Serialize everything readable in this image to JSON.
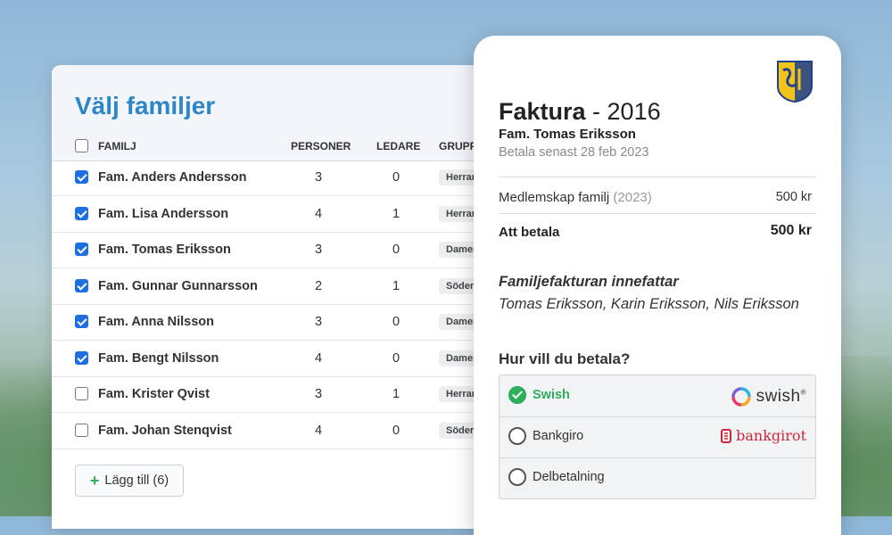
{
  "families_panel": {
    "title": "Välj familjer",
    "columns": {
      "family": "FAMILJ",
      "persons": "PERSONER",
      "leaders": "LEDARE",
      "group": "GRUPP"
    },
    "rows": [
      {
        "name": "Fam. Anders Andersson",
        "persons": "3",
        "leaders": "0",
        "group": "Herrar",
        "checked": true
      },
      {
        "name": "Fam. Lisa Andersson",
        "persons": "4",
        "leaders": "1",
        "group": "Herrar",
        "checked": true
      },
      {
        "name": "Fam. Tomas Eriksson",
        "persons": "3",
        "leaders": "0",
        "group": "Damer",
        "checked": true
      },
      {
        "name": "Fam. Gunnar Gunnarsson",
        "persons": "2",
        "leaders": "1",
        "group": "Söder",
        "checked": true
      },
      {
        "name": "Fam. Anna Nilsson",
        "persons": "3",
        "leaders": "0",
        "group": "Damer",
        "checked": true
      },
      {
        "name": "Fam. Bengt Nilsson",
        "persons": "4",
        "leaders": "0",
        "group": "Damer",
        "checked": true
      },
      {
        "name": "Fam. Krister Qvist",
        "persons": "3",
        "leaders": "1",
        "group": "Herrar",
        "checked": false
      },
      {
        "name": "Fam. Johan Stenqvist",
        "persons": "4",
        "leaders": "0",
        "group": "Söder",
        "checked": false
      }
    ],
    "add_button": "Lägg till (6)",
    "add_icon": "plus-icon"
  },
  "invoice": {
    "title_bold": "Faktura",
    "title_rest": " - 2016",
    "family": "Fam. Tomas Eriksson",
    "due": "Betala senast 28 feb 2023",
    "item_label": "Medlemskap familj",
    "item_year": "(2023)",
    "item_amount": "500 kr",
    "total_label": "Att betala",
    "total_amount": "500 kr",
    "includes_heading": "Familjefakturan innefattar",
    "includes_names": "Tomas Eriksson, Karin Eriksson, Nils Eriksson",
    "payment_heading": "Hur vill du betala?",
    "payment_options": [
      {
        "label": "Swish",
        "brand": "swish",
        "selected": true
      },
      {
        "label": "Bankgiro",
        "brand": "bankgirot",
        "selected": false
      },
      {
        "label": "Delbetalning",
        "brand": "",
        "selected": false
      }
    ],
    "colors": {
      "accent_blue": "#2e86c8",
      "checkbox_blue": "#1f6fe0",
      "swish_green": "#2eae5b",
      "bankgirot_red": "#d0263a"
    }
  }
}
